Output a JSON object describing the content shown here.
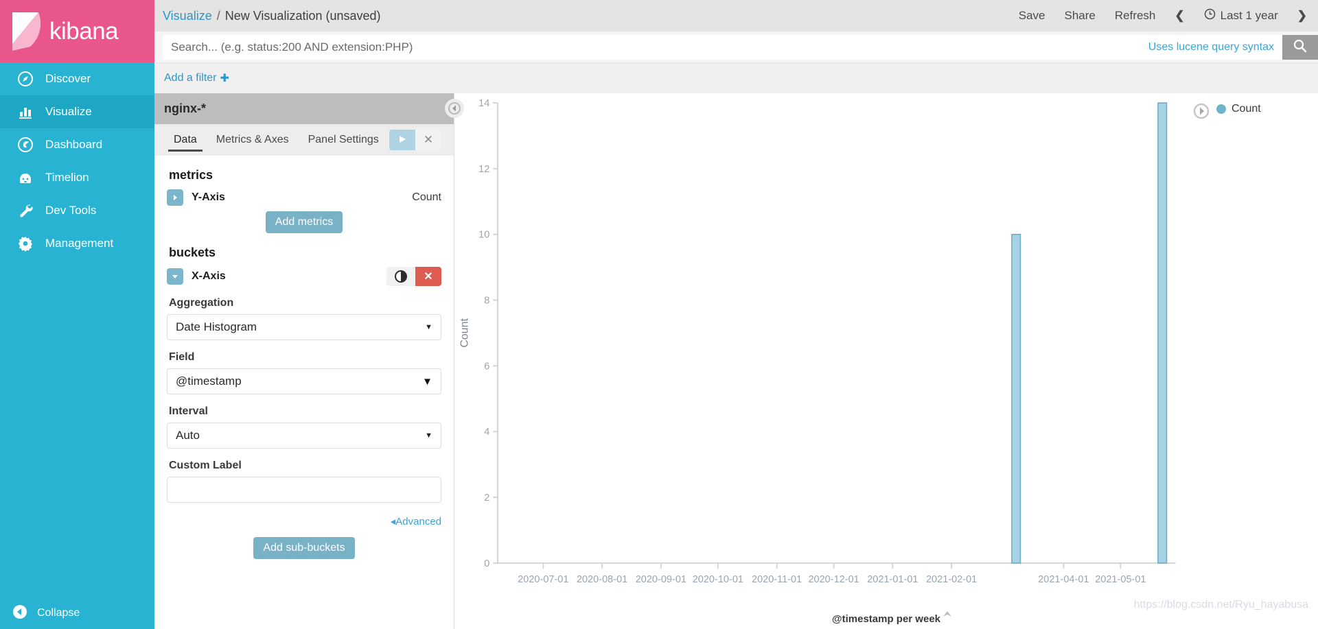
{
  "brand": {
    "name": "kibana",
    "color": "#e9568c",
    "nav_color": "#29b3d2"
  },
  "sidebar": {
    "items": [
      {
        "label": "Discover",
        "icon": "compass-icon",
        "active": false
      },
      {
        "label": "Visualize",
        "icon": "bar-chart-icon",
        "active": true
      },
      {
        "label": "Dashboard",
        "icon": "dashboard-icon",
        "active": false
      },
      {
        "label": "Timelion",
        "icon": "timelion-icon",
        "active": false
      },
      {
        "label": "Dev Tools",
        "icon": "wrench-icon",
        "active": false
      },
      {
        "label": "Management",
        "icon": "gear-icon",
        "active": false
      }
    ],
    "collapse_label": "Collapse"
  },
  "topbar": {
    "breadcrumb_root": "Visualize",
    "breadcrumb_sep": "/",
    "breadcrumb_current": "New Visualization (unsaved)",
    "save_label": "Save",
    "share_label": "Share",
    "refresh_label": "Refresh",
    "time_range": "Last 1 year",
    "prev_icon": "chevron-left-icon",
    "next_icon": "chevron-right-icon",
    "clock_icon": "clock-icon"
  },
  "query": {
    "value": "",
    "placeholder": "Search... (e.g. status:200 AND extension:PHP)",
    "hint": "Uses lucene query syntax",
    "search_icon": "search-icon"
  },
  "filters": {
    "add_label": "Add a filter",
    "add_icon": "plus-icon"
  },
  "editor": {
    "index_pattern": "nginx-*",
    "tabs": [
      {
        "label": "Data",
        "active": true
      },
      {
        "label": "Metrics & Axes",
        "active": false
      },
      {
        "label": "Panel Settings",
        "active": false
      }
    ],
    "apply_icon": "play-icon",
    "cancel_icon": "close-icon",
    "metrics": {
      "heading": "metrics",
      "y_axis_label": "Y-Axis",
      "y_axis_value": "Count",
      "add_metrics_label": "Add metrics"
    },
    "buckets": {
      "heading": "buckets",
      "x_axis_label": "X-Axis",
      "toggle_icon": "toggle-switch-icon",
      "delete_icon": "delete-icon",
      "aggregation_label": "Aggregation",
      "aggregation_value": "Date Histogram",
      "field_label": "Field",
      "field_value": "@timestamp",
      "interval_label": "Interval",
      "interval_value": "Auto",
      "custom_label_label": "Custom Label",
      "custom_label_value": "",
      "advanced_label": "Advanced",
      "add_sub_buckets_label": "Add sub-buckets"
    }
  },
  "chart_panel": {
    "collapse_icon": "chevron-left-circle-icon",
    "legend_toggle_icon": "chevron-right-circle-icon",
    "scroll_up_icon": "chevron-up-icon",
    "watermark": "https://blog.csdn.net/Ryu_hayabusa"
  },
  "chart_data": {
    "type": "bar",
    "title": "",
    "xlabel": "@timestamp per week",
    "ylabel": "Count",
    "ylim": [
      0,
      14
    ],
    "yticks": [
      0,
      2,
      4,
      6,
      8,
      10,
      12,
      14
    ],
    "grid": false,
    "legend_position": "right",
    "legend": [
      "Count"
    ],
    "series": [
      {
        "name": "Count",
        "color": "#a6d3e3",
        "stroke": "#6aa9c4",
        "points": [
          {
            "x": "2021-03-07",
            "y": 10
          },
          {
            "x": "2021-05-23",
            "y": 14
          }
        ]
      }
    ],
    "xticks": [
      "2020-07-01",
      "2020-08-01",
      "2020-09-01",
      "2020-10-01",
      "2020-11-01",
      "2020-12-01",
      "2021-01-01",
      "2021-02-01",
      "2021-04-01",
      "2021-05-01"
    ],
    "x_domain_start": "2020-06-07",
    "x_domain_end": "2021-05-30"
  }
}
